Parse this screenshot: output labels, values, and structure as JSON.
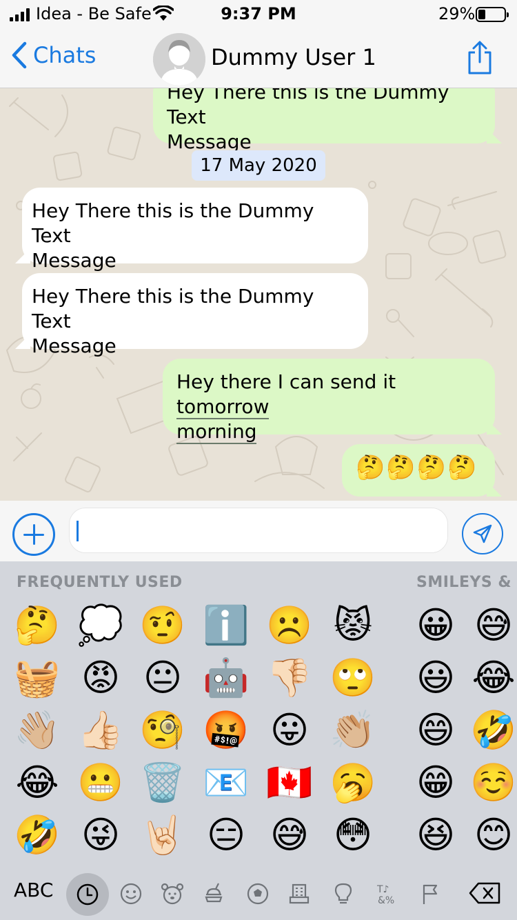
{
  "status": {
    "carrier": "Idea - Be Safe",
    "time": "9:37 PM",
    "battery": "29%"
  },
  "nav": {
    "back_label": "Chats",
    "contact_name": "Dummy User 1"
  },
  "chat": {
    "top_partial": {
      "line1": "Hey There this is the Dummy Text",
      "line2": "Message"
    },
    "date_chip": "17 May 2020",
    "incoming": [
      {
        "line1": "Hey There this is the Dummy Text",
        "line2": "Message"
      },
      {
        "line1": "Hey There this is the Dummy Text",
        "line2": "Message"
      }
    ],
    "outgoing": {
      "line1a": "Hey there I can send it ",
      "line1b": "tomorrow",
      "line2": "morning"
    },
    "emoji_message": [
      "🤔",
      "🤔",
      "🤔",
      "🤔"
    ]
  },
  "input": {
    "value": "",
    "placeholder": ""
  },
  "keyboard": {
    "section_frequent": "FREQUENTLY USED",
    "section_smileys": "SMILEYS & P",
    "frequent": [
      [
        "🤔",
        "💭",
        "🤨",
        "ℹ️",
        "☹️",
        "😾"
      ],
      [
        "🧺",
        "😡",
        "😐",
        "🤖",
        "👎🏻",
        "🙄"
      ],
      [
        "👋🏼",
        "👍🏻",
        "🧐",
        "🤬",
        "😛",
        "👏🏼"
      ],
      [
        "😂",
        "😬",
        "🗑️",
        "📧",
        "🇨🇦",
        "🥱"
      ],
      [
        "🤣",
        "😜",
        "🤘🏻",
        "😑",
        "😅",
        "😳"
      ]
    ],
    "smileys": [
      [
        "😀",
        "😅"
      ],
      [
        "😃",
        "😂"
      ],
      [
        "😄",
        "🤣"
      ],
      [
        "😁",
        "☺️"
      ],
      [
        "😆",
        "😊"
      ]
    ],
    "abc_label": "ABC",
    "categories": [
      "clock-icon",
      "smiley-icon",
      "animal-icon",
      "food-icon",
      "ball-icon",
      "building-icon",
      "bulb-icon",
      "symbols-icon",
      "flag-icon",
      "backspace-icon"
    ]
  },
  "colors": {
    "accent": "#1a7ae0",
    "outgoing": "#dcf8c6",
    "incoming": "#ffffff",
    "chat_bg": "#e8e2d7"
  }
}
